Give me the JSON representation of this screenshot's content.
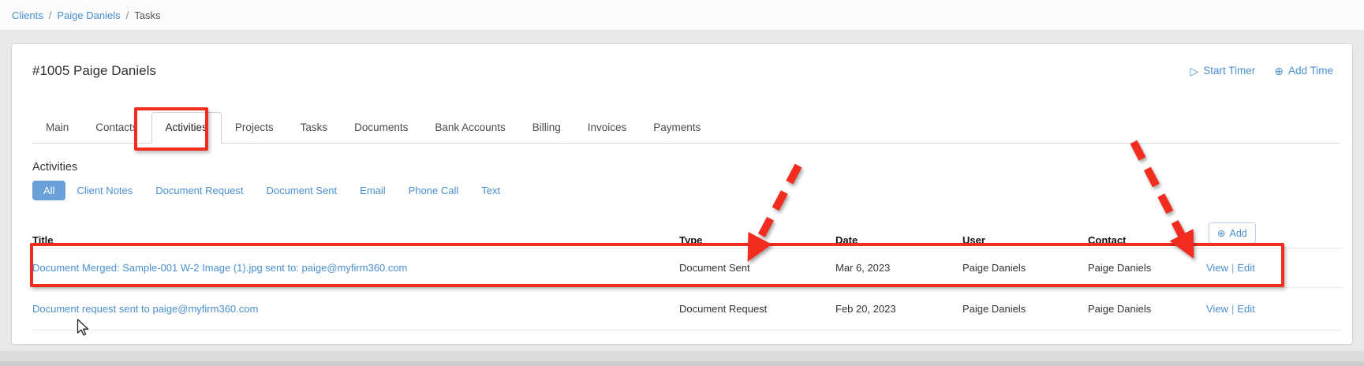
{
  "breadcrumb": {
    "separator": "/",
    "items": [
      {
        "label": "Clients"
      },
      {
        "label": "Paige Daniels"
      },
      {
        "label": "Tasks"
      }
    ]
  },
  "header": {
    "client_title": "#1005 Paige Daniels",
    "start_timer": "Start Timer",
    "add_time": "Add Time"
  },
  "tabs": {
    "active": "Activities",
    "items": [
      "Main",
      "Contacts",
      "Activities",
      "Projects",
      "Tasks",
      "Documents",
      "Bank Accounts",
      "Billing",
      "Invoices",
      "Payments"
    ]
  },
  "activities": {
    "heading": "Activities",
    "filters": {
      "active": "All",
      "items": [
        "All",
        "Client Notes",
        "Document Request",
        "Document Sent",
        "Email",
        "Phone Call",
        "Text"
      ]
    },
    "add_button": "Add",
    "table": {
      "columns": [
        "Title",
        "Type",
        "Date",
        "User",
        "Contact"
      ],
      "action_separator": "|",
      "rows": [
        {
          "title": "Document Merged: Sample-001 W-2 Image (1).jpg sent to: paige@myfirm360.com",
          "type": "Document Sent",
          "date": "Mar 6, 2023",
          "user": "Paige Daniels",
          "contact": "Paige Daniels",
          "view": "View",
          "edit": "Edit"
        },
        {
          "title": "Document request sent to paige@myfirm360.com",
          "type": "Document Request",
          "date": "Feb 20, 2023",
          "user": "Paige Daniels",
          "contact": "Paige Daniels",
          "view": "View",
          "edit": "Edit"
        }
      ]
    }
  },
  "annotations": {
    "red_color": "#f22c1e",
    "highlighted_tab": "Activities",
    "highlighted_row_title": "Document Merged: Sample-001 W-2 Image (1).jpg sent to: paige@myfirm360.com",
    "arrow_1_target": "Document Sent",
    "arrow_2_target": "View | Edit"
  },
  "colors": {
    "link_blue": "#4a8fce",
    "filter_active_bg": "#6aa0d8",
    "annotation_red": "#f22c1e"
  }
}
